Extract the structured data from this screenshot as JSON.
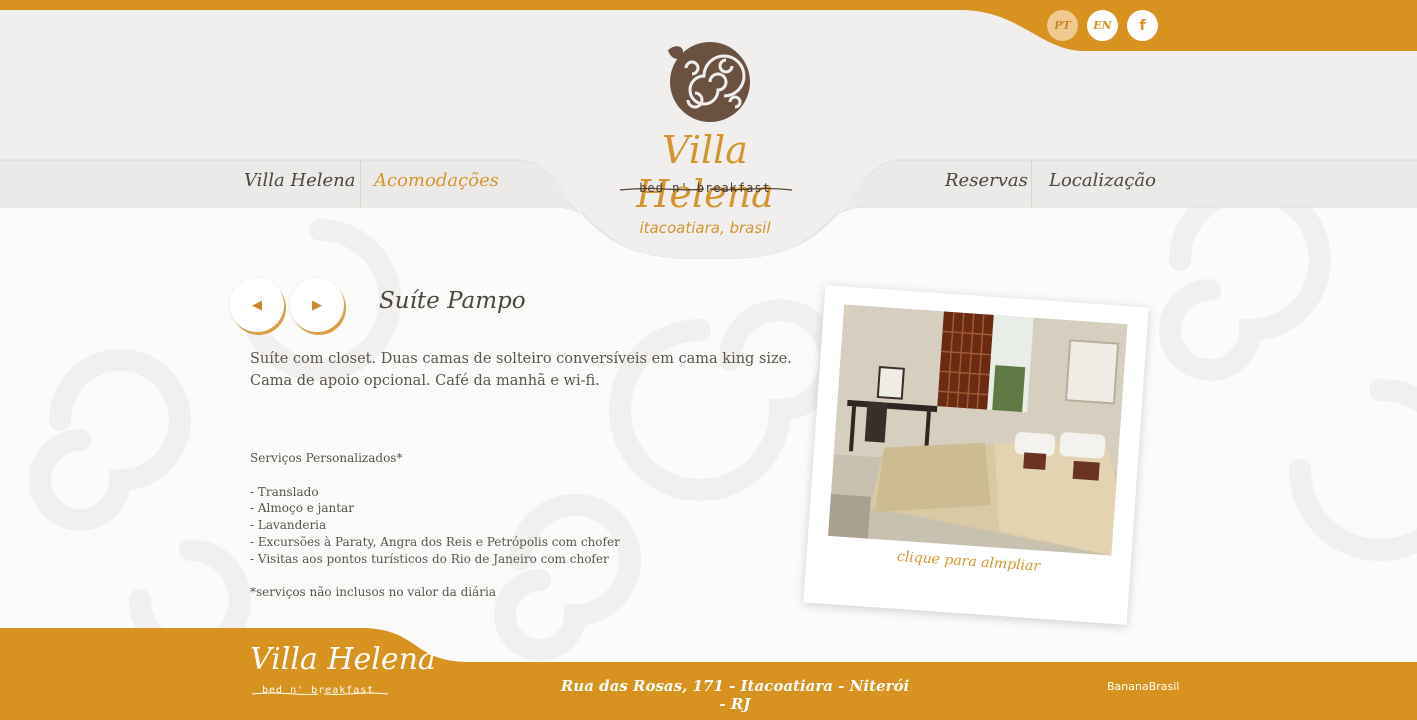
{
  "colors": {
    "accent": "#d4952e",
    "band": "#f0efee",
    "text": "#4b4640"
  },
  "lang": {
    "pt": "PT",
    "en": "EN",
    "fb": "f"
  },
  "nav": {
    "villa_helena": "Villa Helena",
    "acomodacoes": "Acomodações",
    "reservas": "Reservas",
    "localizacao": "Localização"
  },
  "logo": {
    "name": "Villa Helena",
    "sub": "bed n' breakfast",
    "location": "itacoatiara, brasil"
  },
  "room": {
    "prev_icon": "◀",
    "next_icon": "▶",
    "title": "Suíte Pampo",
    "desc_line1": "Suíte com closet. Duas camas de solteiro conversíveis em cama king size.",
    "desc_line2": "Cama de apoio opcional. Café da manhã e wi-fi."
  },
  "services": {
    "heading": "Serviços Personalizados*",
    "items": [
      "- Translado",
      "- Almoço e jantar",
      "- Lavanderia",
      "- Excursões à Paraty, Angra dos Reis e Petrópolis com chofer",
      "- Visitas aos pontos turísticos do Rio de Janeiro com chofer"
    ],
    "footnote": "*serviços não inclusos no valor da diária"
  },
  "photo": {
    "zoom_label": "clique para almpliar"
  },
  "footer": {
    "logo_name": "Villa Helena",
    "logo_sub": "bed n' breakfast",
    "address": "Rua das Rosas, 171 - Itacoatiara - Niterói - RJ",
    "credit": "BananaBrasil"
  }
}
